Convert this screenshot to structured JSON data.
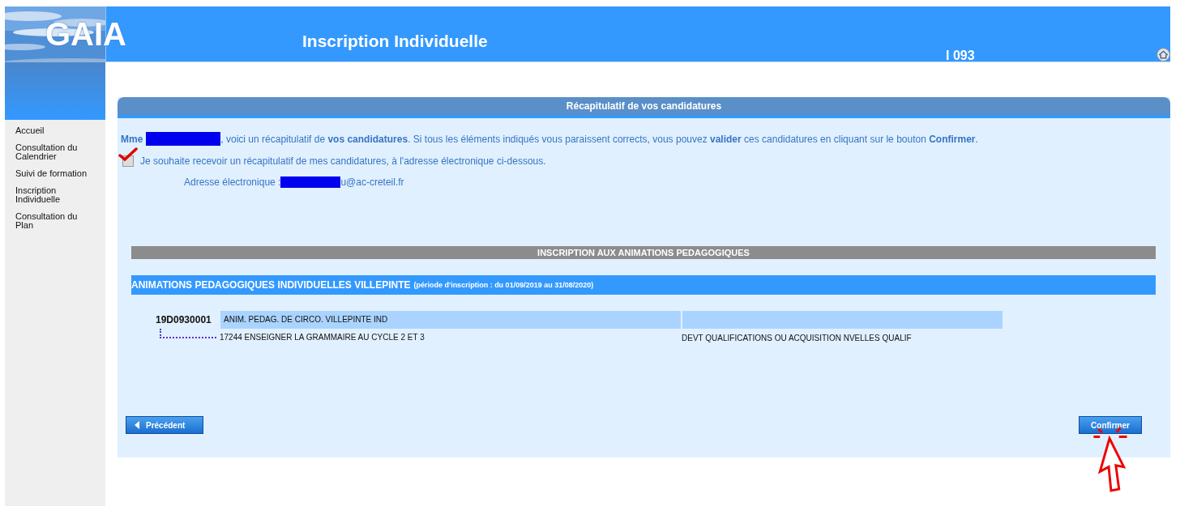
{
  "header": {
    "logo": "GAIA",
    "title": "Inscription Individuelle",
    "code": "I 093"
  },
  "sidebar": {
    "items": [
      {
        "label": "Accueil",
        "selected": false
      },
      {
        "label": "Consultation du Calendrier",
        "selected": false
      },
      {
        "label": "Suivi de formation",
        "selected": false
      },
      {
        "label": "Inscription Individuelle",
        "selected": false
      },
      {
        "label": "Consultation du Plan",
        "selected": false
      }
    ]
  },
  "panel": {
    "title": "Récapitulatif de vos candidatures",
    "greeting": "Mme",
    "intro": ", voici un récapitulatif de **vos candidatures**. Si tous les éléments indiqués vous paraissent corrects, vous pouvez **valider** ces candidatures en cliquant sur le bouton **Confirmer**.",
    "email_option": {
      "label": "Je souhaite recevoir un récapitulatif de mes candidatures, à l'adresse électronique ci-dessous.",
      "checked": true
    },
    "email": {
      "label": "Adresse électronique :",
      "value_end": "u@ac-creteil.fr"
    },
    "section_title": "INSCRIPTION AUX ANIMATIONS PEDAGOGIQUES",
    "group": {
      "title": "ANIMATIONS PEDAGOGIQUES INDIVIDUELLES VILLEPINTE",
      "period": "(période d'inscription : du 01/09/2019 au 31/08/2020)"
    },
    "entries": [
      {
        "code": "19D0930001",
        "name": "ANIM. PEDAG. DE CIRCO. VILLEPINTE IND",
        "children": [
          {
            "name": "17244 ENSEIGNER LA GRAMMAIRE AU CYCLE 2 ET 3",
            "category": "DEVT QUALIFICATIONS OU ACQUISITION NVELLES QUALIF"
          }
        ]
      }
    ],
    "buttons": [
      {
        "label": "Précédent",
        "kind": "back"
      },
      {
        "label": "Confirmer",
        "kind": "confirm"
      }
    ]
  }
}
